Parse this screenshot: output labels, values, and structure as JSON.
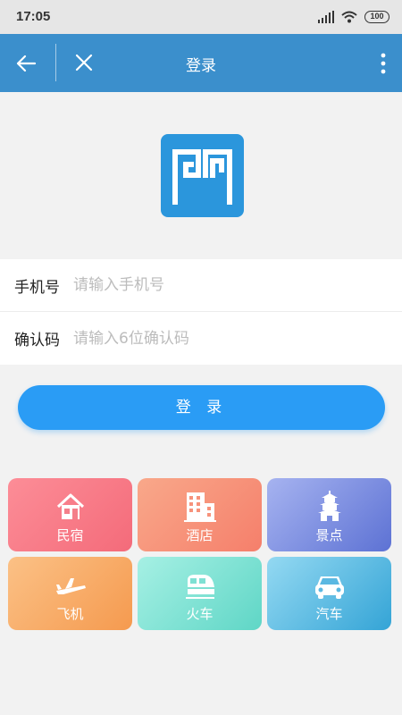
{
  "status_bar": {
    "time": "17:05",
    "battery": "100"
  },
  "nav": {
    "title": "登录"
  },
  "form": {
    "phone_label": "手机号",
    "phone_placeholder": "请输入手机号",
    "code_label": "确认码",
    "code_placeholder": "请输入6位确认码"
  },
  "login_button": "登 录",
  "services": [
    {
      "label": "民宿",
      "icon": "house-icon"
    },
    {
      "label": "酒店",
      "icon": "building-icon"
    },
    {
      "label": "景点",
      "icon": "pagoda-icon"
    },
    {
      "label": "飞机",
      "icon": "airplane-icon"
    },
    {
      "label": "火车",
      "icon": "train-icon"
    },
    {
      "label": "汽车",
      "icon": "car-icon"
    }
  ],
  "colors": {
    "nav_bar": "#3b8fcc",
    "logo": "#2b96dc",
    "login_button": "#2a9cf5",
    "tile_minsu": "#f46b7a",
    "tile_hotel": "#f57f6b",
    "tile_scenic": "#5d72d4",
    "tile_flight": "#f59a4f",
    "tile_train": "#5fd6c6",
    "tile_car": "#34a4d6"
  }
}
